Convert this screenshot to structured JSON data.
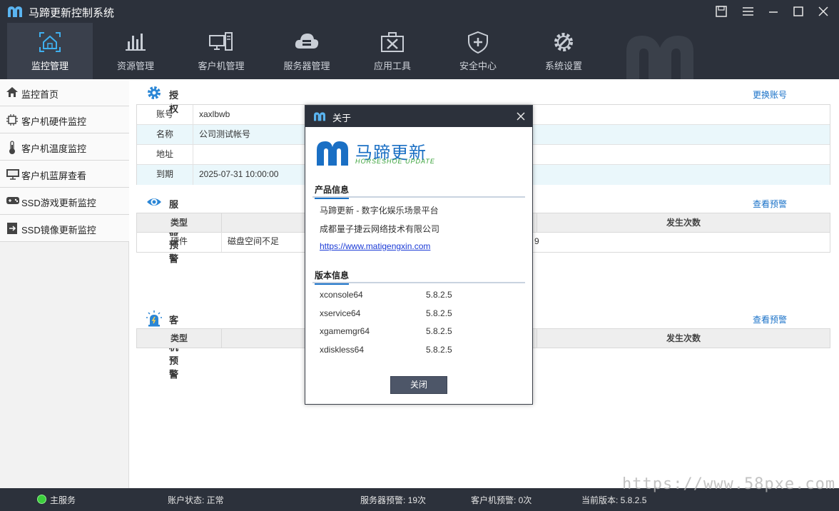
{
  "app": {
    "title": "马蹄更新控制系统"
  },
  "nav": [
    {
      "label": "监控管理",
      "icon": "home-monitor-icon",
      "active": true
    },
    {
      "label": "资源管理",
      "icon": "bar-chart-icon"
    },
    {
      "label": "客户机管理",
      "icon": "computers-icon"
    },
    {
      "label": "服务器管理",
      "icon": "cloud-server-icon"
    },
    {
      "label": "应用工具",
      "icon": "toolbox-icon"
    },
    {
      "label": "安全中心",
      "icon": "shield-plus-icon"
    },
    {
      "label": "系统设置",
      "icon": "gear-wrench-icon"
    }
  ],
  "sidebar": [
    {
      "label": "监控首页",
      "icon": "house-icon"
    },
    {
      "label": "客户机硬件监控",
      "icon": "cpu-chip-icon"
    },
    {
      "label": "客户机温度监控",
      "icon": "thermometer-icon"
    },
    {
      "label": "客户机蓝屏查看",
      "icon": "monitor-icon"
    },
    {
      "label": "SSD游戏更新监控",
      "icon": "gamepad-icon"
    },
    {
      "label": "SSD镜像更新监控",
      "icon": "mirror-update-icon"
    }
  ],
  "auth": {
    "title": "授权",
    "link": "更换账号",
    "rows": [
      {
        "label": "账号",
        "value": "xaxlbwb"
      },
      {
        "label": "名称",
        "value": "公司测试帐号"
      },
      {
        "label": "地址",
        "value": ""
      },
      {
        "label": "到期",
        "value": "2025-07-31 10:00:00"
      }
    ]
  },
  "server_alert": {
    "title": "服务器预警",
    "link": "查看预警",
    "headers": {
      "type": "类型",
      "count": "发生次数"
    },
    "row": {
      "type": "硬件",
      "desc": "磁盘空间不足",
      "count_fragment": "9"
    }
  },
  "client_alert": {
    "title": "客户机预警",
    "link": "查看预警",
    "headers": {
      "type": "类型",
      "count": "发生次数"
    }
  },
  "status": {
    "service": "主服务",
    "account": "账户状态:   正常",
    "server_alerts": "服务器预警:   19次",
    "client_alerts": "客户机预警:   0次",
    "version": "当前版本:   5.8.2.5"
  },
  "watermark": "https://www.58pxe.com",
  "about": {
    "title": "关于",
    "brand_cn": "马蹄更新",
    "brand_en": "HORSESHOE UPDATE",
    "product_heading": "产品信息",
    "product_lines": [
      "马蹄更新 - 数字化娱乐场景平台",
      "成都量子捷云网络技术有限公司"
    ],
    "url": "https://www.matigengxin.com",
    "version_heading": "版本信息",
    "versions": [
      {
        "name": "xconsole64",
        "ver": "5.8.2.5"
      },
      {
        "name": "xservice64",
        "ver": "5.8.2.5"
      },
      {
        "name": "xgamemgr64",
        "ver": "5.8.2.5"
      },
      {
        "name": "xdiskless64",
        "ver": "5.8.2.5"
      }
    ],
    "close_label": "关闭"
  },
  "colors": {
    "chrome": "#2c313b",
    "accent": "#1a72c8",
    "row_alt": "#eaf7fb",
    "brand_green": "#3aa33a"
  }
}
